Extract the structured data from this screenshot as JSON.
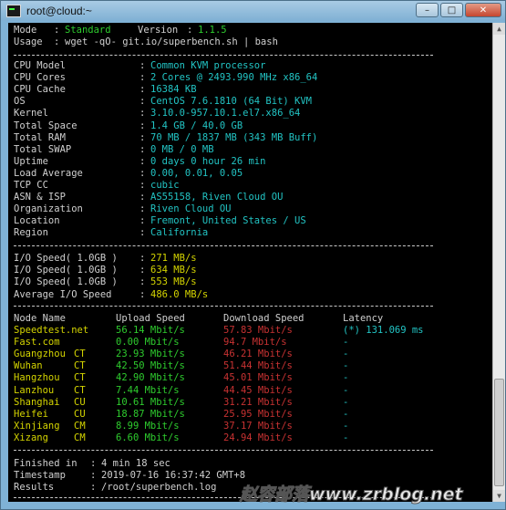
{
  "window": {
    "title": "root@cloud:~"
  },
  "controls": {
    "minimize": "–",
    "maximize": "□",
    "close": "✕"
  },
  "header": [
    {
      "label": "Mode",
      "colon": ":",
      "value": "Standard",
      "version_label": "Version",
      "version_colon": ":",
      "version_value": "1.1.5"
    },
    {
      "label": "Usage",
      "colon": ":",
      "value": "wget -qO- git.io/superbench.sh | bash"
    }
  ],
  "system": [
    {
      "key": "CPU Model",
      "value": "Common KVM processor"
    },
    {
      "key": "CPU Cores",
      "value": "2 Cores @ 2493.990 MHz x86_64"
    },
    {
      "key": "CPU Cache",
      "value": "16384 KB"
    },
    {
      "key": "OS",
      "value": "CentOS 7.6.1810 (64 Bit) KVM"
    },
    {
      "key": "Kernel",
      "value": "3.10.0-957.10.1.el7.x86_64"
    },
    {
      "key": "Total Space",
      "value": "1.4 GB / 40.0 GB"
    },
    {
      "key": "Total RAM",
      "value": "70 MB / 1837 MB (343 MB Buff)"
    },
    {
      "key": "Total SWAP",
      "value": "0 MB / 0 MB"
    },
    {
      "key": "Uptime",
      "value": "0 days 0 hour 26 min"
    },
    {
      "key": "Load Average",
      "value": "0.00, 0.01, 0.05"
    },
    {
      "key": "TCP CC",
      "value": "cubic"
    },
    {
      "key": "ASN & ISP",
      "value": "AS55158, Riven Cloud OU"
    },
    {
      "key": "Organization",
      "value": "Riven Cloud OU"
    },
    {
      "key": "Location",
      "value": "Fremont, United States / US"
    },
    {
      "key": "Region",
      "value": "California"
    }
  ],
  "io": [
    {
      "key": "I/O Speed( 1.0GB )",
      "value": "271 MB/s"
    },
    {
      "key": "I/O Speed( 1.0GB )",
      "value": "634 MB/s"
    },
    {
      "key": "I/O Speed( 1.0GB )",
      "value": "553 MB/s"
    },
    {
      "key": "Average I/O Speed",
      "value": "486.0 MB/s"
    }
  ],
  "speed_headers": {
    "node": "Node Name",
    "upload": "Upload Speed",
    "download": "Download Speed",
    "latency": "Latency"
  },
  "speed": [
    {
      "node": "Speedtest.net",
      "isp": "",
      "upload": "56.14 Mbit/s",
      "download": "57.83 Mbit/s",
      "latency": "(*) 131.069 ms"
    },
    {
      "node": "Fast.com",
      "isp": "",
      "upload": "0.00 Mbit/s",
      "download": "94.7 Mbit/s",
      "latency": "-"
    },
    {
      "node": "Guangzhou",
      "isp": "CT",
      "upload": "23.93 Mbit/s",
      "download": "46.21 Mbit/s",
      "latency": "-"
    },
    {
      "node": "Wuhan",
      "isp": "CT",
      "upload": "42.50 Mbit/s",
      "download": "51.44 Mbit/s",
      "latency": "-"
    },
    {
      "node": "Hangzhou",
      "isp": "CT",
      "upload": "42.90 Mbit/s",
      "download": "45.01 Mbit/s",
      "latency": "-"
    },
    {
      "node": "Lanzhou",
      "isp": "CT",
      "upload": "7.44 Mbit/s",
      "download": "44.45 Mbit/s",
      "latency": "-"
    },
    {
      "node": "Shanghai",
      "isp": "CU",
      "upload": "10.61 Mbit/s",
      "download": "31.21 Mbit/s",
      "latency": "-"
    },
    {
      "node": "Heifei",
      "isp": "CU",
      "upload": "18.87 Mbit/s",
      "download": "25.95 Mbit/s",
      "latency": "-"
    },
    {
      "node": "Xinjiang",
      "isp": "CM",
      "upload": "8.99 Mbit/s",
      "download": "37.17 Mbit/s",
      "latency": "-"
    },
    {
      "node": "Xizang",
      "isp": "CM",
      "upload": "6.60 Mbit/s",
      "download": "24.94 Mbit/s",
      "latency": "-"
    }
  ],
  "footer": [
    {
      "key": "Finished in",
      "value": "4 min 18 sec"
    },
    {
      "key": "Timestamp",
      "value": "2019-07-16 16:37:42 GMT+8"
    },
    {
      "key": "Results",
      "value": "/root/superbench.log"
    }
  ],
  "watermark": "赵容部落www.zrblog.net",
  "colors": {
    "cyan": "#22c4c4",
    "yellow": "#d4d400",
    "green": "#2ecc2e",
    "red": "#c83232",
    "blue": "#3a7bd5",
    "separator": "#c8c8c8"
  }
}
